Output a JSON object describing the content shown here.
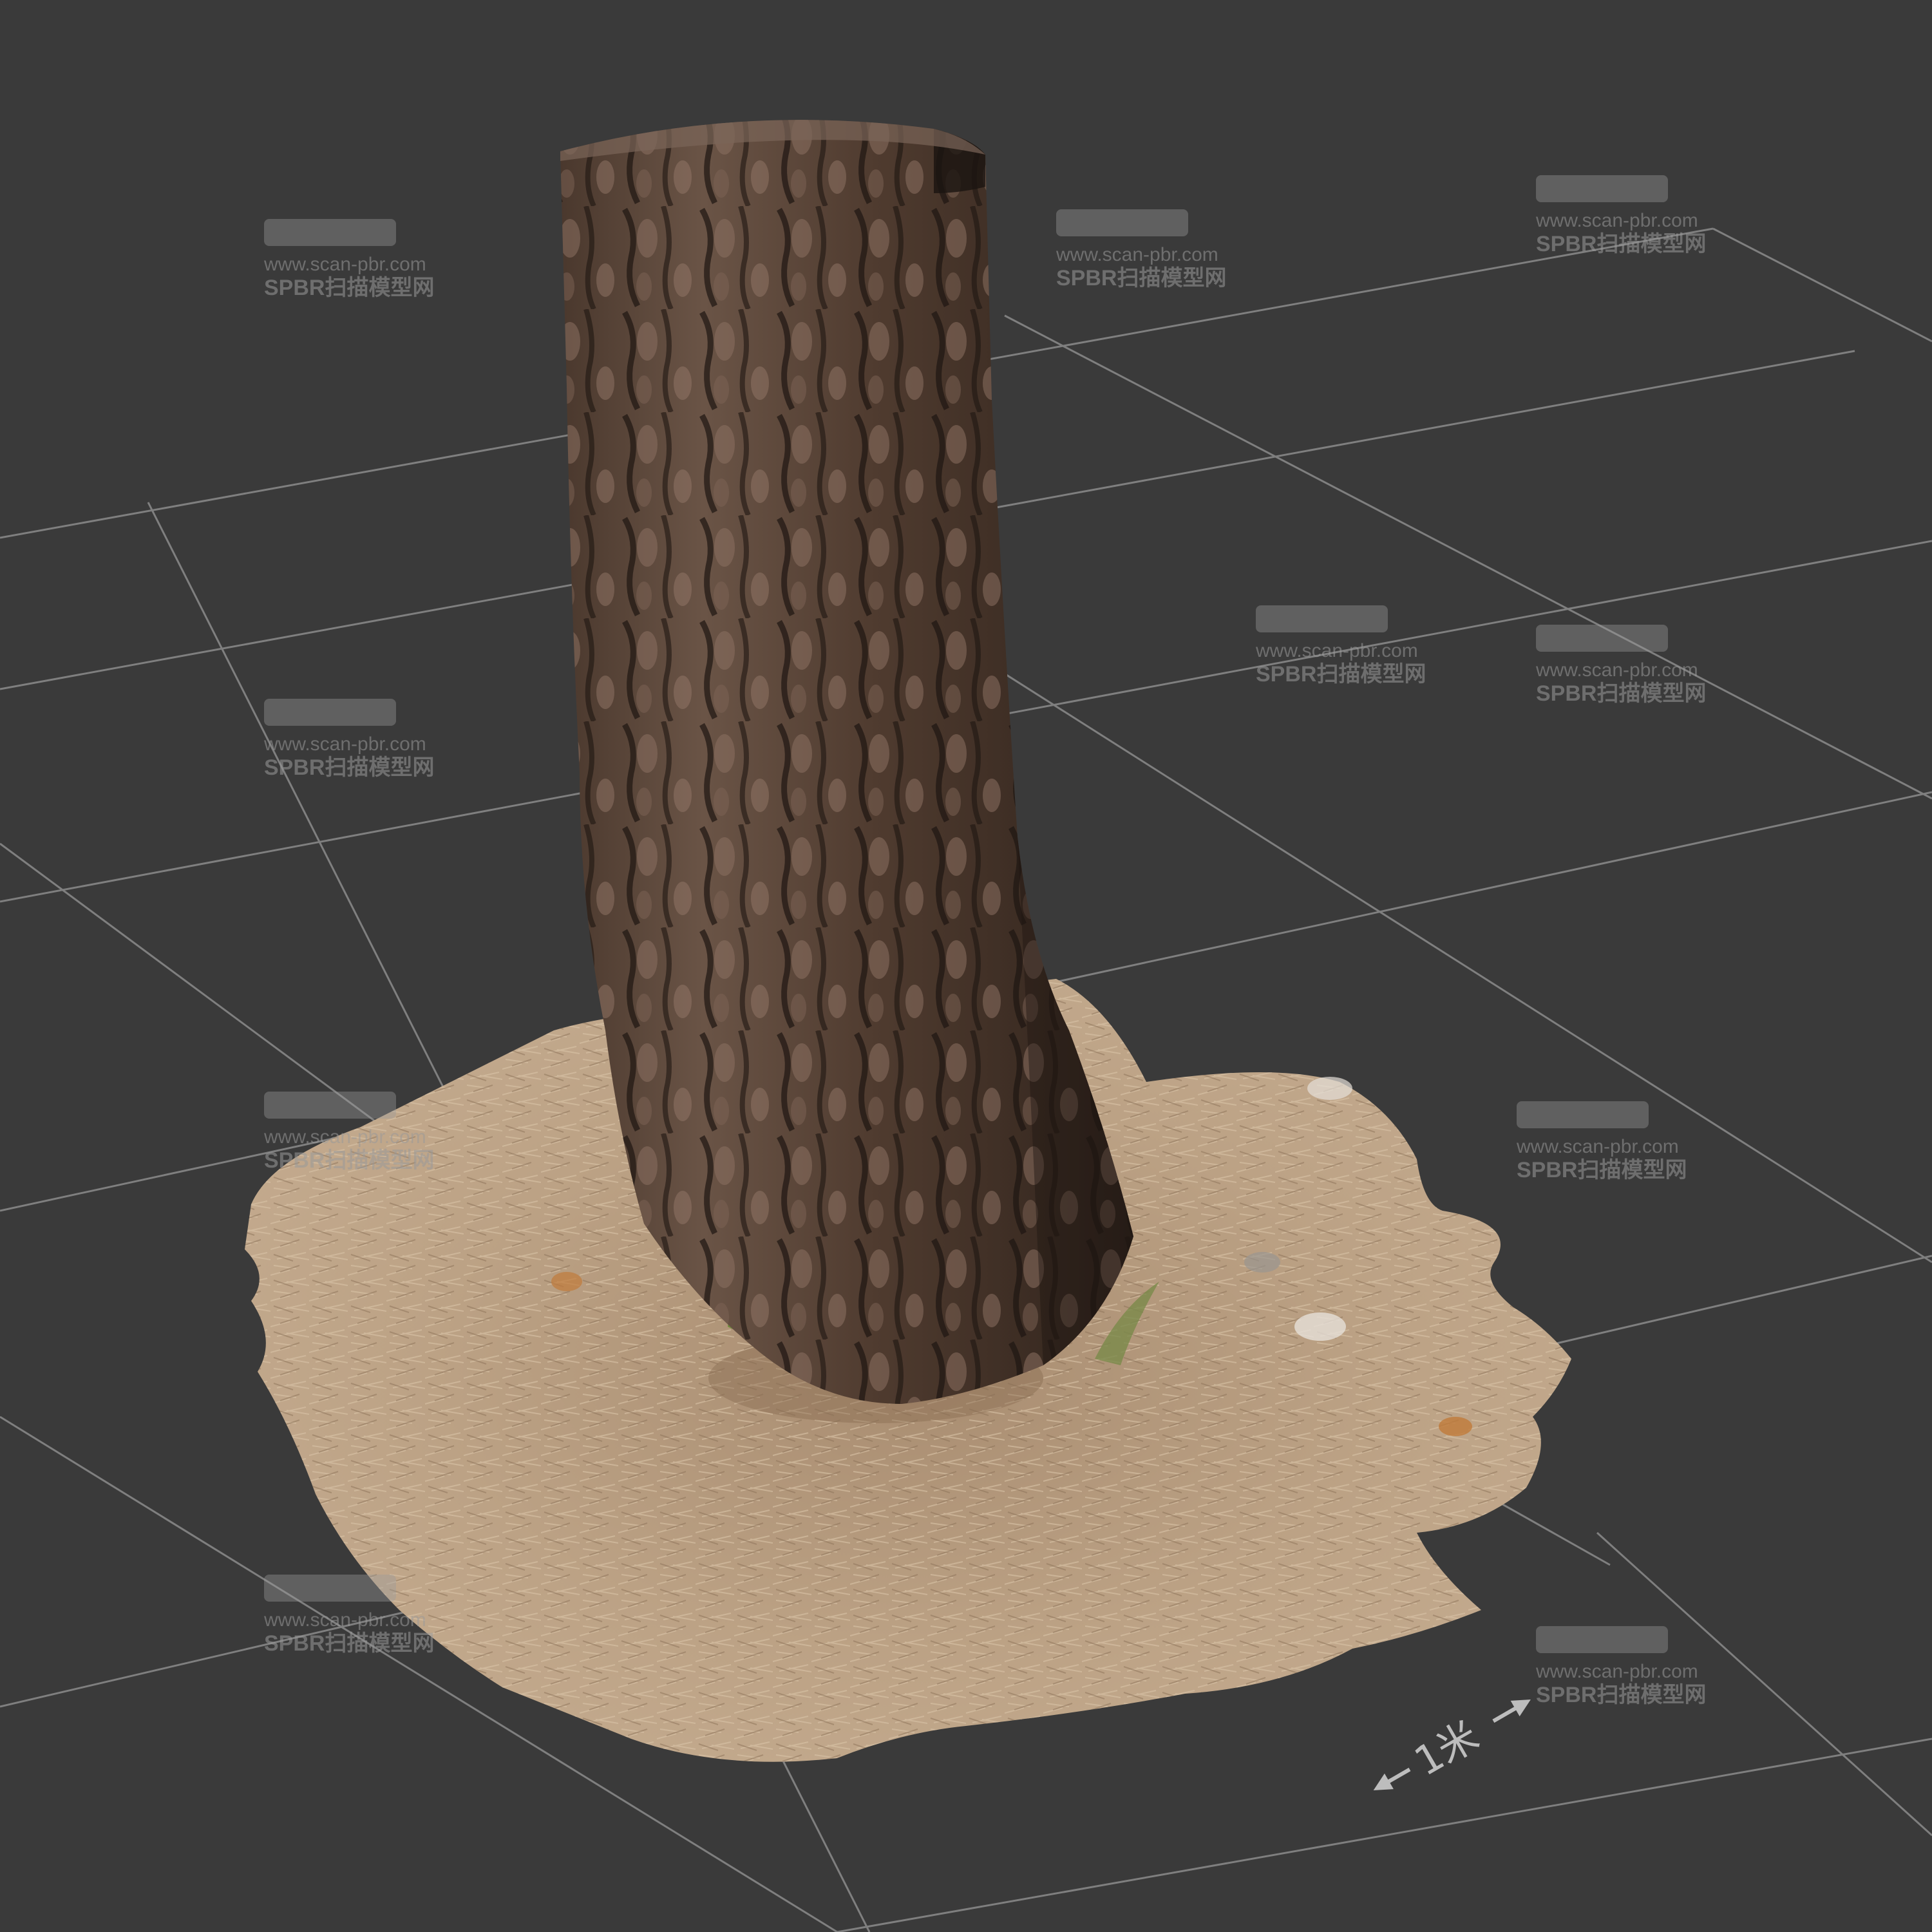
{
  "scene": {
    "scale_label": "1米",
    "watermark": {
      "url": "www.scan-pbr.com",
      "brand": "SPBR扫描模型网"
    },
    "colors": {
      "background": "#3a3a3a",
      "grid": "#7d7d7d",
      "bark_dark": "#2a1f18",
      "bark_mid": "#5a4234",
      "bark_light": "#8d7566",
      "ground": "#b79d80"
    }
  }
}
